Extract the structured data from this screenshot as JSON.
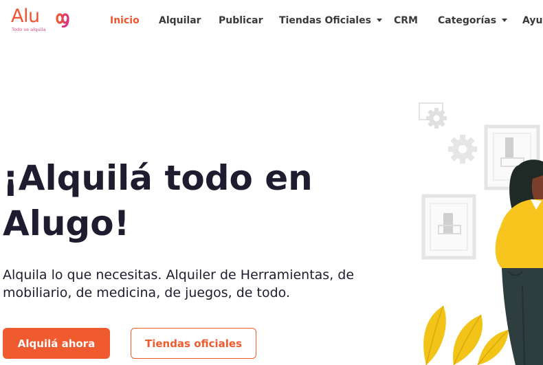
{
  "brand": {
    "name_prefix": "Alu",
    "tagline": "Todo se alquila",
    "primary_color": "#f05a2f",
    "accent_color": "#e0467a",
    "logo_icon": "infinity-g-icon"
  },
  "nav": {
    "items": [
      {
        "label": "Inicio",
        "active": true
      },
      {
        "label": "Alquilar"
      },
      {
        "label": "Publicar"
      },
      {
        "label": "Tiendas Oficiales",
        "dropdown": true
      },
      {
        "label": "CRM"
      },
      {
        "label": "Categorías",
        "dropdown": true
      },
      {
        "label": "Ayuda"
      }
    ]
  },
  "hero": {
    "title": "¡Alquilá todo en Alugo!",
    "subtitle": "Alquila lo que necesitas. Alquiler de Herramientas, de mobiliario, de medicina, de juegos, de todo.",
    "primary_button": "Alquilá ahora",
    "secondary_button": "Tiendas oficiales"
  },
  "illustration": {
    "icon": "woman-with-frames-illustration",
    "colors": {
      "shirt": "#f7c51e",
      "pants": "#2e3d3d",
      "frames": "#e6e6e6",
      "leaves": "#f2c418"
    }
  }
}
